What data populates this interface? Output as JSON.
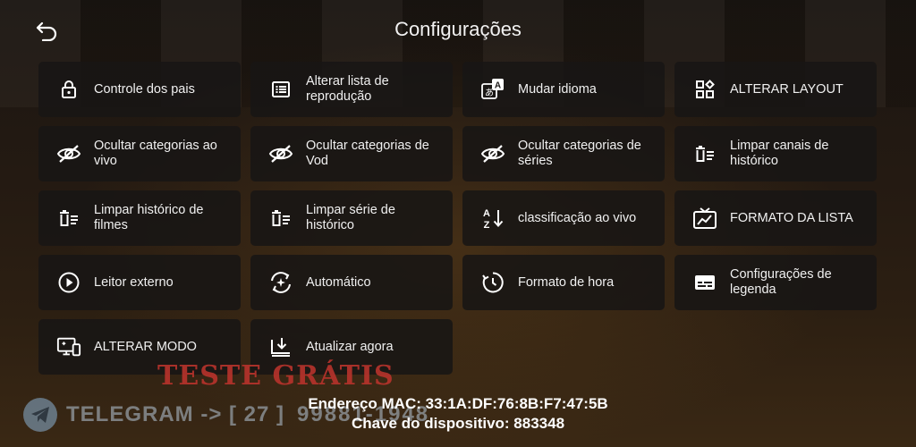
{
  "header": {
    "title": "Configurações",
    "back_icon": "back-arrow-icon"
  },
  "tiles": [
    {
      "label": "Controle dos pais",
      "icon": "lock-icon"
    },
    {
      "label": "Alterar lista de reprodução",
      "icon": "list-icon"
    },
    {
      "label": "Mudar idioma",
      "icon": "translate-icon"
    },
    {
      "label": "ALTERAR LAYOUT",
      "icon": "layout-icon"
    },
    {
      "label": "Ocultar categorias ao vivo",
      "icon": "eye-off-icon"
    },
    {
      "label": "Ocultar categorias de Vod",
      "icon": "eye-off-icon"
    },
    {
      "label": "Ocultar categorias de séries",
      "icon": "eye-off-icon"
    },
    {
      "label": "Limpar canais de histórico",
      "icon": "clear-list-icon"
    },
    {
      "label": "Limpar histórico de filmes",
      "icon": "clear-list-icon"
    },
    {
      "label": "Limpar série de histórico",
      "icon": "clear-list-icon"
    },
    {
      "label": "classificação ao vivo",
      "icon": "sort-az-icon"
    },
    {
      "label": "FORMATO DA LISTA",
      "icon": "tv-chart-icon"
    },
    {
      "label": "Leitor externo",
      "icon": "play-circle-icon"
    },
    {
      "label": "Automático",
      "icon": "auto-icon"
    },
    {
      "label": "Formato de hora",
      "icon": "clock-icon"
    },
    {
      "label": "Configurações de legenda",
      "icon": "subtitles-icon"
    },
    {
      "label": "ALTERAR MODO",
      "icon": "devices-icon"
    },
    {
      "label": "Atualizar agora",
      "icon": "download-icon"
    }
  ],
  "footer": {
    "mac": "Endereço MAC: 33:1A:DF:76:8B:F7:47:5B",
    "device_key": "Chave do dispositivo: 883348"
  },
  "overlay": {
    "promo": "TESTE GRÁTIS",
    "telegram": "TELEGRAM -> [ 27 ]",
    "phone": "99881-1948"
  }
}
